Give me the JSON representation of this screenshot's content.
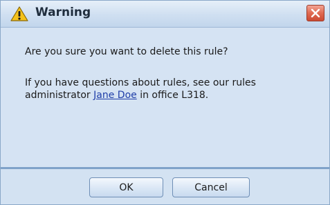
{
  "window": {
    "title": "Warning",
    "icon": "warning-icon",
    "close_icon": "close-icon"
  },
  "message": {
    "question": "Are you sure you want to delete this rule?",
    "info_line1": "If you have questions about rules, see our rules",
    "info_line2_prefix": "administrator ",
    "admin_link": "Jane Doe",
    "info_line2_suffix": " in office L318."
  },
  "buttons": {
    "ok": "OK",
    "cancel": "Cancel"
  },
  "colors": {
    "background": "#d3e2f2",
    "separator": "#7fa2c9",
    "link": "#1f3ea8",
    "close_button": "#e06a52",
    "warning_icon": "#f5c21b"
  }
}
